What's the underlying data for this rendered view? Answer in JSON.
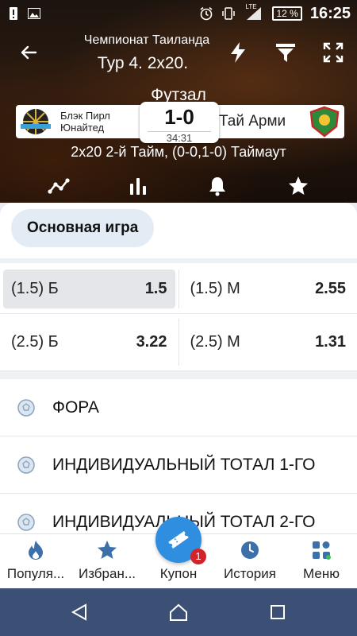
{
  "statusbar": {
    "network": "LTE",
    "battery": "12 %",
    "time": "16:25"
  },
  "header": {
    "championship": "Чемпионат Таиланда",
    "round": "Тур 4. 2х20.",
    "sport": "Футзал",
    "team_home": "Блэк Пирл Юнайтед",
    "team_home_line1": "Блэк Пирл",
    "team_home_line2": "Юнайтед",
    "team_away": "Тай Арми",
    "score": "1-0",
    "match_time": "34:31",
    "period_info": "2х20 2-й Тайм, (0-0,1-0) Таймаут"
  },
  "content": {
    "main_tab": "Основная игра",
    "market_rows": [
      [
        {
          "label": "(1.5) Б",
          "odd": "1.5",
          "selected": true
        },
        {
          "label": "(1.5) М",
          "odd": "2.55"
        }
      ],
      [
        {
          "label": "(2.5) Б",
          "odd": "3.22"
        },
        {
          "label": "(2.5) М",
          "odd": "1.31"
        }
      ]
    ],
    "groups": [
      "ФОРА",
      "ИНДИВИДУАЛЬНЫЙ ТОТАЛ 1-ГО",
      "ИНДИВИДУАЛЬНЫЙ ТОТАЛ 2-ГО"
    ]
  },
  "bottomnav": {
    "popular": "Популя...",
    "favorites": "Избран...",
    "coupon": "Купон",
    "coupon_count": "1",
    "history": "История",
    "menu": "Меню"
  },
  "colors": {
    "accent": "#2f8ee0",
    "badge": "#d3232a",
    "sysnav": "#3b5074"
  }
}
